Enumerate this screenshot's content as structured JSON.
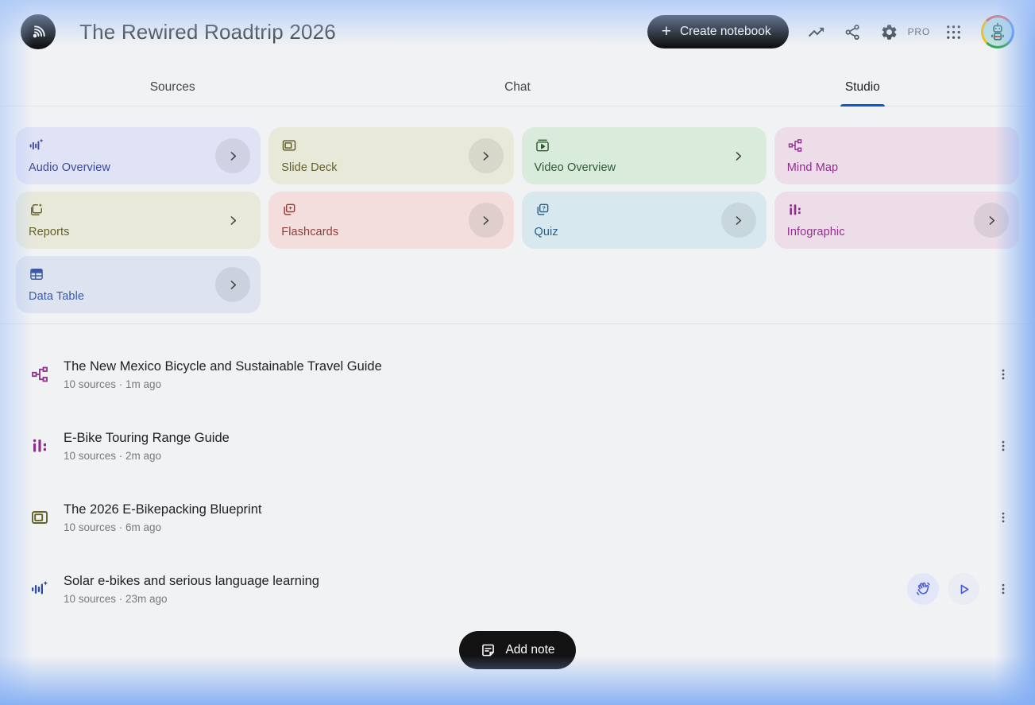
{
  "header": {
    "title": "The Rewired Roadtrip 2026",
    "create_button_label": "Create notebook",
    "pro_badge": "PRO"
  },
  "tabs": [
    {
      "label": "Sources",
      "active": false
    },
    {
      "label": "Chat",
      "active": false
    },
    {
      "label": "Studio",
      "active": true
    }
  ],
  "studio": {
    "cards": [
      {
        "label": "Audio Overview",
        "icon": "audio-waveform-icon",
        "bg": "#dfe3f5",
        "fg": "#3a4a9c",
        "chevron": "circle"
      },
      {
        "label": "Slide Deck",
        "icon": "slide-deck-icon",
        "bg": "#e9e9da",
        "fg": "#64602a",
        "chevron": "circle"
      },
      {
        "label": "Video Overview",
        "icon": "video-overview-icon",
        "bg": "#d9ebdb",
        "fg": "#2c5934",
        "chevron": "plain"
      },
      {
        "label": "Mind Map",
        "icon": "mind-map-icon",
        "bg": "#ecdde9",
        "fg": "#90308c",
        "chevron": "none"
      },
      {
        "label": "Reports",
        "icon": "report-icon",
        "bg": "#e9e9da",
        "fg": "#64602a",
        "chevron": "plain"
      },
      {
        "label": "Flashcards",
        "icon": "flashcards-icon",
        "bg": "#f3dedd",
        "fg": "#8f3d38",
        "chevron": "circle"
      },
      {
        "label": "Quiz",
        "icon": "quiz-icon",
        "bg": "#d8e8ef",
        "fg": "#2a5c8f",
        "chevron": "circle"
      },
      {
        "label": "Infographic",
        "icon": "infographic-icon",
        "bg": "#ecdde9",
        "fg": "#90308c",
        "chevron": "circle"
      },
      {
        "label": "Data Table",
        "icon": "data-table-icon",
        "bg": "#dde3ef",
        "fg": "#3a5aa5",
        "chevron": "circle"
      }
    ]
  },
  "notes_list": {
    "items": [
      {
        "title": "The New Mexico Bicycle and Sustainable Travel Guide",
        "meta": "10 sources · 1m ago",
        "icon": "mind-map-icon",
        "icon_color": "#90308c"
      },
      {
        "title": "E-Bike Touring Range Guide",
        "meta": "10 sources · 2m ago",
        "icon": "infographic-icon",
        "icon_color": "#90308c"
      },
      {
        "title": "The 2026 E-Bikepacking Blueprint",
        "meta": "10 sources · 6m ago",
        "icon": "slide-deck-icon",
        "icon_color": "#64602a"
      },
      {
        "title": "Solar e-bikes and serious language learning",
        "meta": "10 sources · 23m ago",
        "icon": "audio-waveform-icon",
        "icon_color": "#2d4e9e"
      }
    ],
    "add_note_label": "Add note"
  },
  "colors": {
    "accent_blue": "#0b57d0",
    "button_black": "#131314"
  }
}
